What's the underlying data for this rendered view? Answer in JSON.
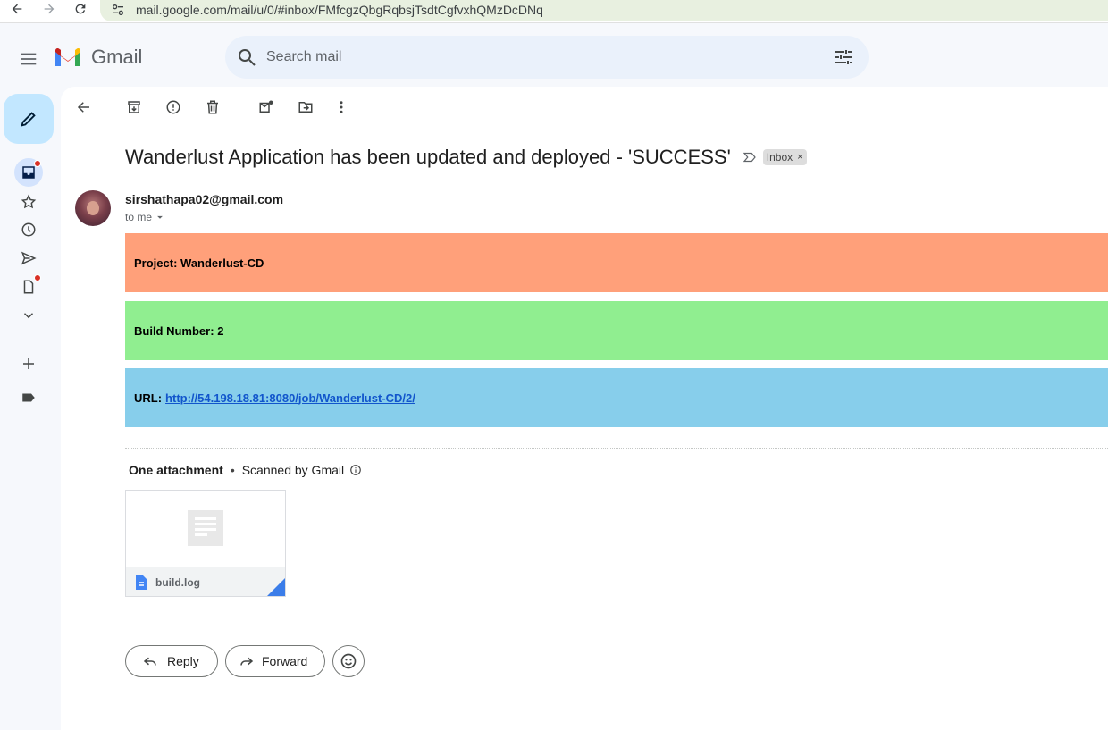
{
  "browser": {
    "url": "mail.google.com/mail/u/0/#inbox/FMfcgzQbgRqbsjTsdtCgfvxhQMzDcDNq"
  },
  "header": {
    "app_name": "Gmail",
    "search_placeholder": "Search mail"
  },
  "email": {
    "subject": "Wanderlust Application has been updated and deployed - 'SUCCESS'",
    "label": "Inbox",
    "label_remove": "×",
    "sender": "sirshathapa02@gmail.com",
    "recipient": "to me",
    "body": {
      "project_label": "Project:",
      "project_value": "Wanderlust-CD",
      "build_label": "Build Number:",
      "build_value": "2",
      "url_label": "URL:",
      "url_value": "http://54.198.18.81:8080/job/Wanderlust-CD/2/"
    },
    "band_colors": {
      "project": "#ffa07a",
      "build": "#90ee90",
      "url": "#87ceeb"
    },
    "attachments": {
      "heading": "One attachment",
      "separator": "•",
      "scan_text": "Scanned by Gmail",
      "file_name": "build.log"
    }
  },
  "actions": {
    "reply": "Reply",
    "forward": "Forward"
  }
}
